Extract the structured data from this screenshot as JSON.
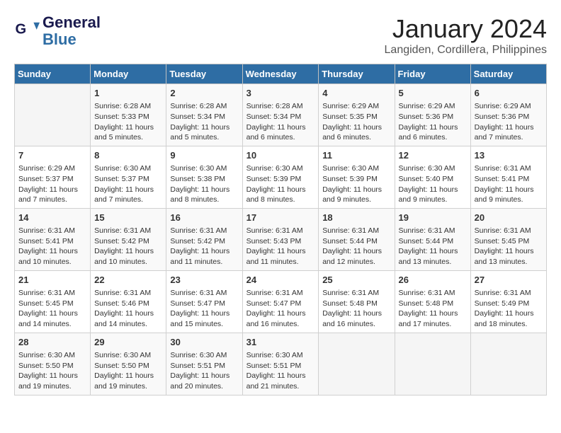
{
  "header": {
    "logo_line1": "General",
    "logo_line2": "Blue",
    "month_year": "January 2024",
    "location": "Langiden, Cordillera, Philippines"
  },
  "days_of_week": [
    "Sunday",
    "Monday",
    "Tuesday",
    "Wednesday",
    "Thursday",
    "Friday",
    "Saturday"
  ],
  "weeks": [
    [
      {
        "day": "",
        "info": ""
      },
      {
        "day": "1",
        "info": "Sunrise: 6:28 AM\nSunset: 5:33 PM\nDaylight: 11 hours\nand 5 minutes."
      },
      {
        "day": "2",
        "info": "Sunrise: 6:28 AM\nSunset: 5:34 PM\nDaylight: 11 hours\nand 5 minutes."
      },
      {
        "day": "3",
        "info": "Sunrise: 6:28 AM\nSunset: 5:34 PM\nDaylight: 11 hours\nand 6 minutes."
      },
      {
        "day": "4",
        "info": "Sunrise: 6:29 AM\nSunset: 5:35 PM\nDaylight: 11 hours\nand 6 minutes."
      },
      {
        "day": "5",
        "info": "Sunrise: 6:29 AM\nSunset: 5:36 PM\nDaylight: 11 hours\nand 6 minutes."
      },
      {
        "day": "6",
        "info": "Sunrise: 6:29 AM\nSunset: 5:36 PM\nDaylight: 11 hours\nand 7 minutes."
      }
    ],
    [
      {
        "day": "7",
        "info": "Sunrise: 6:29 AM\nSunset: 5:37 PM\nDaylight: 11 hours\nand 7 minutes."
      },
      {
        "day": "8",
        "info": "Sunrise: 6:30 AM\nSunset: 5:37 PM\nDaylight: 11 hours\nand 7 minutes."
      },
      {
        "day": "9",
        "info": "Sunrise: 6:30 AM\nSunset: 5:38 PM\nDaylight: 11 hours\nand 8 minutes."
      },
      {
        "day": "10",
        "info": "Sunrise: 6:30 AM\nSunset: 5:39 PM\nDaylight: 11 hours\nand 8 minutes."
      },
      {
        "day": "11",
        "info": "Sunrise: 6:30 AM\nSunset: 5:39 PM\nDaylight: 11 hours\nand 9 minutes."
      },
      {
        "day": "12",
        "info": "Sunrise: 6:30 AM\nSunset: 5:40 PM\nDaylight: 11 hours\nand 9 minutes."
      },
      {
        "day": "13",
        "info": "Sunrise: 6:31 AM\nSunset: 5:41 PM\nDaylight: 11 hours\nand 9 minutes."
      }
    ],
    [
      {
        "day": "14",
        "info": "Sunrise: 6:31 AM\nSunset: 5:41 PM\nDaylight: 11 hours\nand 10 minutes."
      },
      {
        "day": "15",
        "info": "Sunrise: 6:31 AM\nSunset: 5:42 PM\nDaylight: 11 hours\nand 10 minutes."
      },
      {
        "day": "16",
        "info": "Sunrise: 6:31 AM\nSunset: 5:42 PM\nDaylight: 11 hours\nand 11 minutes."
      },
      {
        "day": "17",
        "info": "Sunrise: 6:31 AM\nSunset: 5:43 PM\nDaylight: 11 hours\nand 11 minutes."
      },
      {
        "day": "18",
        "info": "Sunrise: 6:31 AM\nSunset: 5:44 PM\nDaylight: 11 hours\nand 12 minutes."
      },
      {
        "day": "19",
        "info": "Sunrise: 6:31 AM\nSunset: 5:44 PM\nDaylight: 11 hours\nand 13 minutes."
      },
      {
        "day": "20",
        "info": "Sunrise: 6:31 AM\nSunset: 5:45 PM\nDaylight: 11 hours\nand 13 minutes."
      }
    ],
    [
      {
        "day": "21",
        "info": "Sunrise: 6:31 AM\nSunset: 5:45 PM\nDaylight: 11 hours\nand 14 minutes."
      },
      {
        "day": "22",
        "info": "Sunrise: 6:31 AM\nSunset: 5:46 PM\nDaylight: 11 hours\nand 14 minutes."
      },
      {
        "day": "23",
        "info": "Sunrise: 6:31 AM\nSunset: 5:47 PM\nDaylight: 11 hours\nand 15 minutes."
      },
      {
        "day": "24",
        "info": "Sunrise: 6:31 AM\nSunset: 5:47 PM\nDaylight: 11 hours\nand 16 minutes."
      },
      {
        "day": "25",
        "info": "Sunrise: 6:31 AM\nSunset: 5:48 PM\nDaylight: 11 hours\nand 16 minutes."
      },
      {
        "day": "26",
        "info": "Sunrise: 6:31 AM\nSunset: 5:48 PM\nDaylight: 11 hours\nand 17 minutes."
      },
      {
        "day": "27",
        "info": "Sunrise: 6:31 AM\nSunset: 5:49 PM\nDaylight: 11 hours\nand 18 minutes."
      }
    ],
    [
      {
        "day": "28",
        "info": "Sunrise: 6:30 AM\nSunset: 5:50 PM\nDaylight: 11 hours\nand 19 minutes."
      },
      {
        "day": "29",
        "info": "Sunrise: 6:30 AM\nSunset: 5:50 PM\nDaylight: 11 hours\nand 19 minutes."
      },
      {
        "day": "30",
        "info": "Sunrise: 6:30 AM\nSunset: 5:51 PM\nDaylight: 11 hours\nand 20 minutes."
      },
      {
        "day": "31",
        "info": "Sunrise: 6:30 AM\nSunset: 5:51 PM\nDaylight: 11 hours\nand 21 minutes."
      },
      {
        "day": "",
        "info": ""
      },
      {
        "day": "",
        "info": ""
      },
      {
        "day": "",
        "info": ""
      }
    ]
  ]
}
